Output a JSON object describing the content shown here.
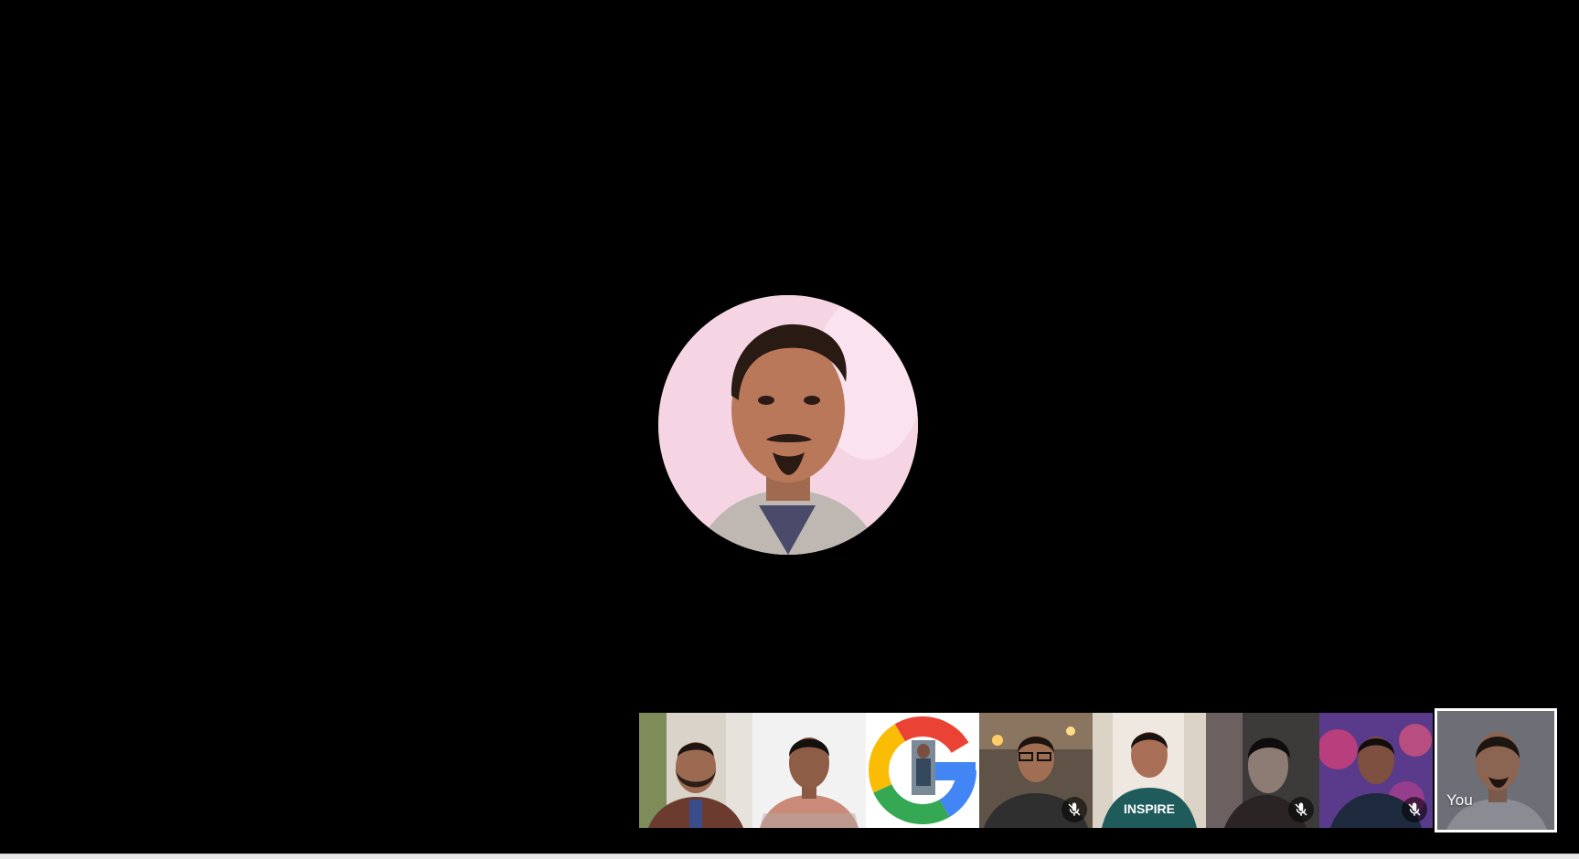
{
  "main_speaker": {
    "avatar_icon": "participant-avatar"
  },
  "filmstrip": {
    "tiles": [
      {
        "icon": "participant-avatar",
        "muted": false
      },
      {
        "icon": "participant-avatar",
        "muted": false
      },
      {
        "icon": "google-logo-avatar",
        "muted": false
      },
      {
        "icon": "participant-avatar",
        "muted": true
      },
      {
        "icon": "participant-avatar",
        "muted": false
      },
      {
        "icon": "participant-avatar",
        "muted": true
      },
      {
        "icon": "participant-avatar",
        "muted": true
      }
    ],
    "self_label": "You"
  },
  "colors": {
    "background": "#000000",
    "self_border": "#ffffff",
    "mute_badge": "#000000"
  }
}
